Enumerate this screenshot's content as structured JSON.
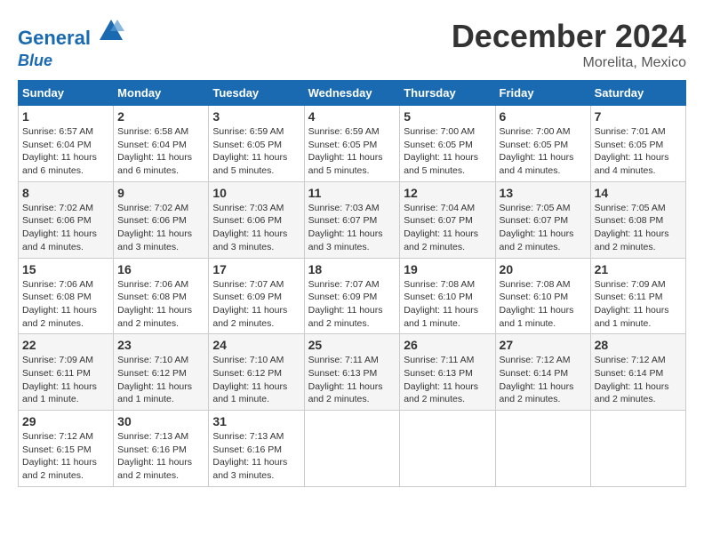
{
  "logo": {
    "line1": "General",
    "line2": "Blue"
  },
  "title": "December 2024",
  "location": "Morelita, Mexico",
  "days_of_week": [
    "Sunday",
    "Monday",
    "Tuesday",
    "Wednesday",
    "Thursday",
    "Friday",
    "Saturday"
  ],
  "weeks": [
    [
      {
        "day": "1",
        "info": "Sunrise: 6:57 AM\nSunset: 6:04 PM\nDaylight: 11 hours and 6 minutes."
      },
      {
        "day": "2",
        "info": "Sunrise: 6:58 AM\nSunset: 6:04 PM\nDaylight: 11 hours and 6 minutes."
      },
      {
        "day": "3",
        "info": "Sunrise: 6:59 AM\nSunset: 6:05 PM\nDaylight: 11 hours and 5 minutes."
      },
      {
        "day": "4",
        "info": "Sunrise: 6:59 AM\nSunset: 6:05 PM\nDaylight: 11 hours and 5 minutes."
      },
      {
        "day": "5",
        "info": "Sunrise: 7:00 AM\nSunset: 6:05 PM\nDaylight: 11 hours and 5 minutes."
      },
      {
        "day": "6",
        "info": "Sunrise: 7:00 AM\nSunset: 6:05 PM\nDaylight: 11 hours and 4 minutes."
      },
      {
        "day": "7",
        "info": "Sunrise: 7:01 AM\nSunset: 6:05 PM\nDaylight: 11 hours and 4 minutes."
      }
    ],
    [
      {
        "day": "8",
        "info": "Sunrise: 7:02 AM\nSunset: 6:06 PM\nDaylight: 11 hours and 4 minutes."
      },
      {
        "day": "9",
        "info": "Sunrise: 7:02 AM\nSunset: 6:06 PM\nDaylight: 11 hours and 3 minutes."
      },
      {
        "day": "10",
        "info": "Sunrise: 7:03 AM\nSunset: 6:06 PM\nDaylight: 11 hours and 3 minutes."
      },
      {
        "day": "11",
        "info": "Sunrise: 7:03 AM\nSunset: 6:07 PM\nDaylight: 11 hours and 3 minutes."
      },
      {
        "day": "12",
        "info": "Sunrise: 7:04 AM\nSunset: 6:07 PM\nDaylight: 11 hours and 2 minutes."
      },
      {
        "day": "13",
        "info": "Sunrise: 7:05 AM\nSunset: 6:07 PM\nDaylight: 11 hours and 2 minutes."
      },
      {
        "day": "14",
        "info": "Sunrise: 7:05 AM\nSunset: 6:08 PM\nDaylight: 11 hours and 2 minutes."
      }
    ],
    [
      {
        "day": "15",
        "info": "Sunrise: 7:06 AM\nSunset: 6:08 PM\nDaylight: 11 hours and 2 minutes."
      },
      {
        "day": "16",
        "info": "Sunrise: 7:06 AM\nSunset: 6:08 PM\nDaylight: 11 hours and 2 minutes."
      },
      {
        "day": "17",
        "info": "Sunrise: 7:07 AM\nSunset: 6:09 PM\nDaylight: 11 hours and 2 minutes."
      },
      {
        "day": "18",
        "info": "Sunrise: 7:07 AM\nSunset: 6:09 PM\nDaylight: 11 hours and 2 minutes."
      },
      {
        "day": "19",
        "info": "Sunrise: 7:08 AM\nSunset: 6:10 PM\nDaylight: 11 hours and 1 minute."
      },
      {
        "day": "20",
        "info": "Sunrise: 7:08 AM\nSunset: 6:10 PM\nDaylight: 11 hours and 1 minute."
      },
      {
        "day": "21",
        "info": "Sunrise: 7:09 AM\nSunset: 6:11 PM\nDaylight: 11 hours and 1 minute."
      }
    ],
    [
      {
        "day": "22",
        "info": "Sunrise: 7:09 AM\nSunset: 6:11 PM\nDaylight: 11 hours and 1 minute."
      },
      {
        "day": "23",
        "info": "Sunrise: 7:10 AM\nSunset: 6:12 PM\nDaylight: 11 hours and 1 minute."
      },
      {
        "day": "24",
        "info": "Sunrise: 7:10 AM\nSunset: 6:12 PM\nDaylight: 11 hours and 1 minute."
      },
      {
        "day": "25",
        "info": "Sunrise: 7:11 AM\nSunset: 6:13 PM\nDaylight: 11 hours and 2 minutes."
      },
      {
        "day": "26",
        "info": "Sunrise: 7:11 AM\nSunset: 6:13 PM\nDaylight: 11 hours and 2 minutes."
      },
      {
        "day": "27",
        "info": "Sunrise: 7:12 AM\nSunset: 6:14 PM\nDaylight: 11 hours and 2 minutes."
      },
      {
        "day": "28",
        "info": "Sunrise: 7:12 AM\nSunset: 6:14 PM\nDaylight: 11 hours and 2 minutes."
      }
    ],
    [
      {
        "day": "29",
        "info": "Sunrise: 7:12 AM\nSunset: 6:15 PM\nDaylight: 11 hours and 2 minutes."
      },
      {
        "day": "30",
        "info": "Sunrise: 7:13 AM\nSunset: 6:16 PM\nDaylight: 11 hours and 2 minutes."
      },
      {
        "day": "31",
        "info": "Sunrise: 7:13 AM\nSunset: 6:16 PM\nDaylight: 11 hours and 3 minutes."
      },
      {
        "day": "",
        "info": ""
      },
      {
        "day": "",
        "info": ""
      },
      {
        "day": "",
        "info": ""
      },
      {
        "day": "",
        "info": ""
      }
    ]
  ]
}
